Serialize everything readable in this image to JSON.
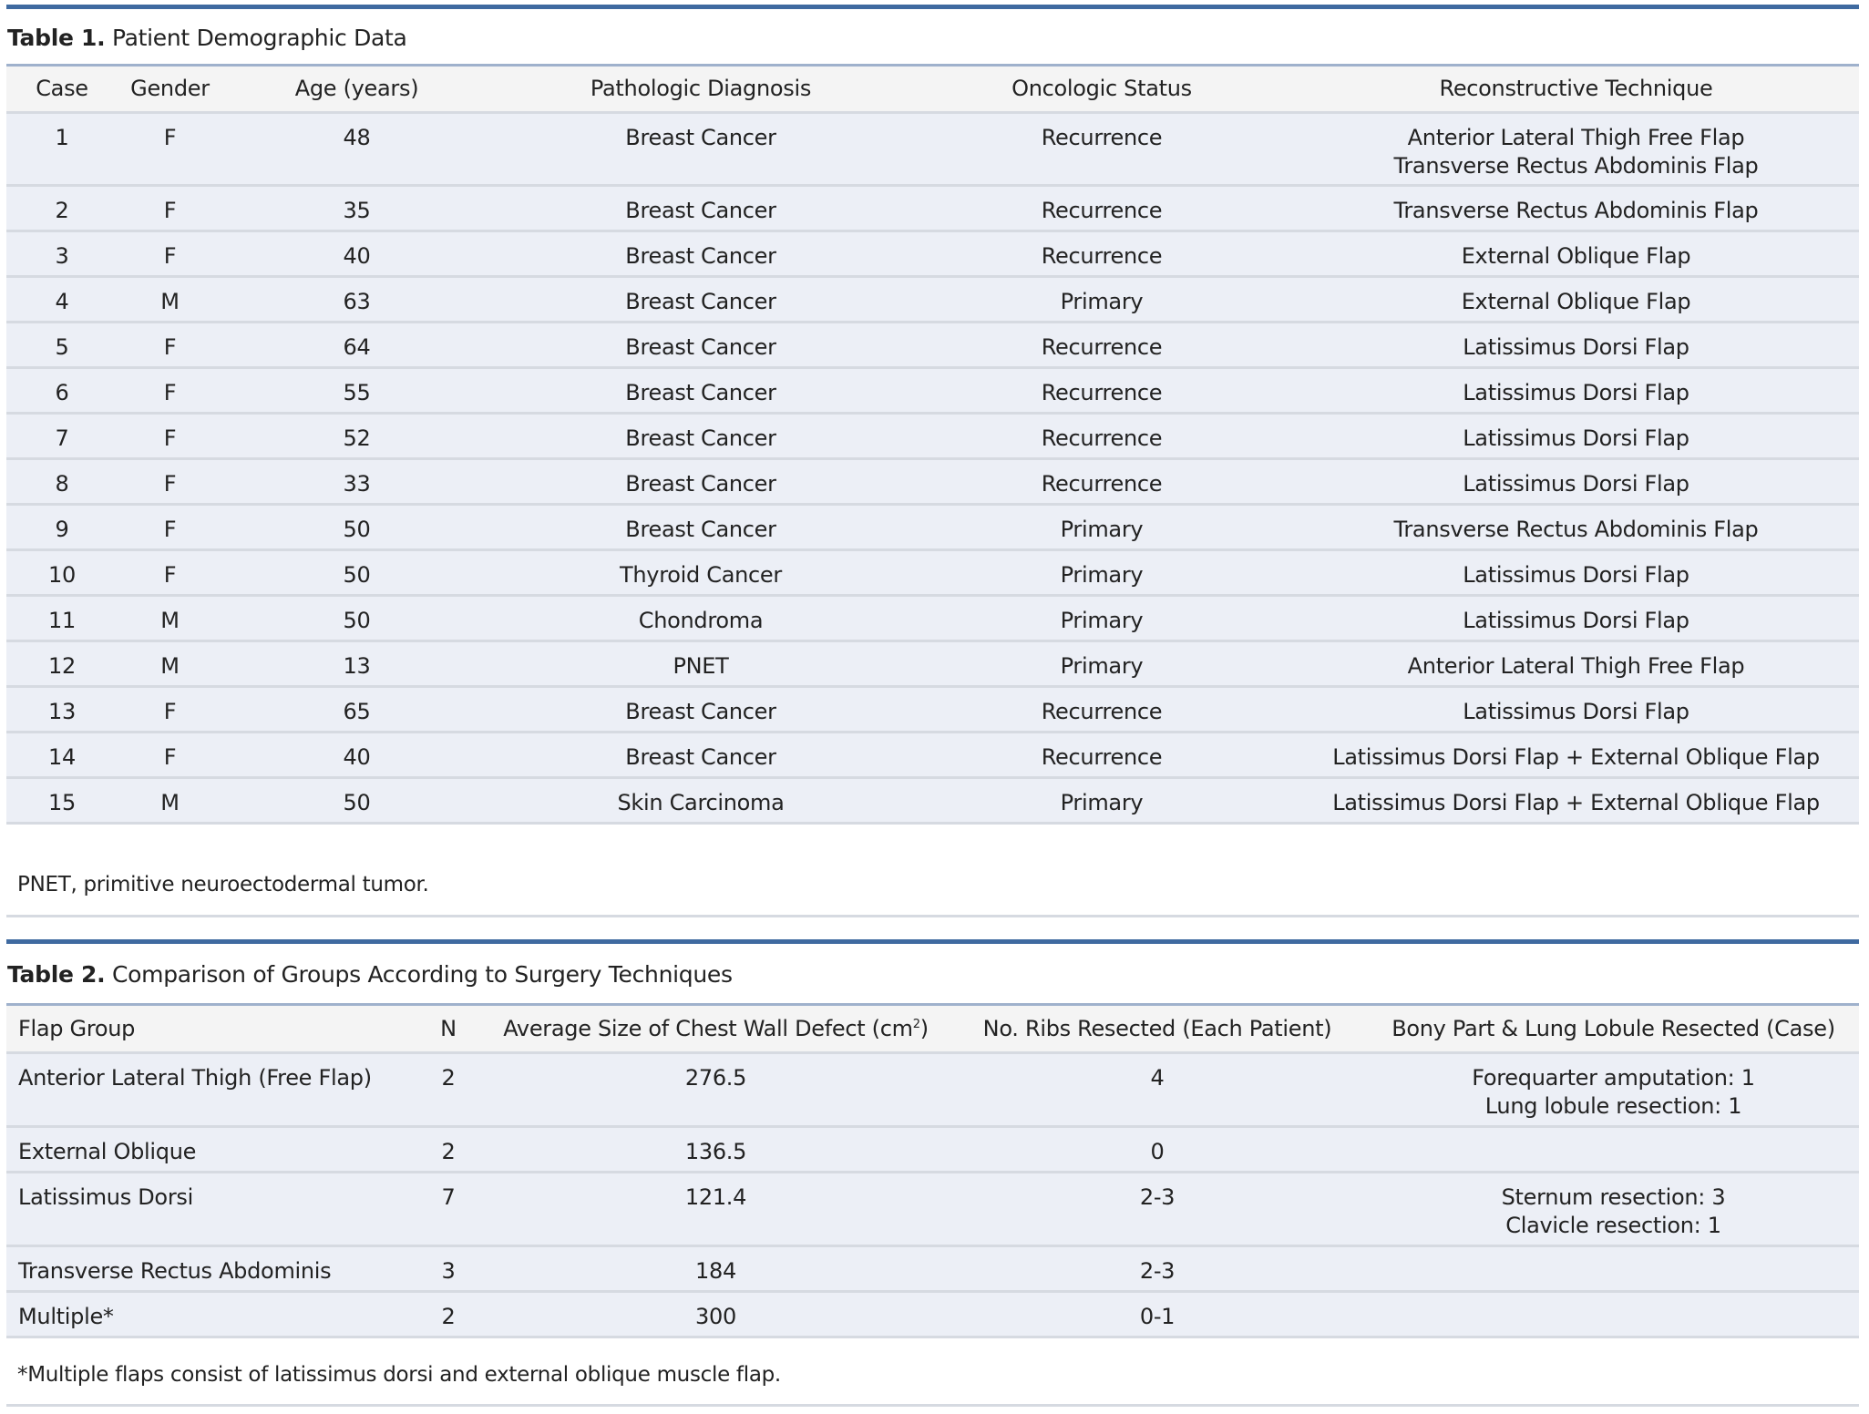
{
  "table1": {
    "label": "Table 1.",
    "title": "Patient Demographic Data",
    "headers": [
      "Case",
      "Gender",
      "Age (years)",
      "Pathologic Diagnosis",
      "Oncologic Status",
      "Reconstructive Technique"
    ],
    "rows": [
      {
        "case": "1",
        "gender": "F",
        "age": "48",
        "diagnosis": "Breast Cancer",
        "status": "Recurrence",
        "technique": [
          "Anterior Lateral Thigh Free Flap",
          "Transverse Rectus Abdominis Flap"
        ]
      },
      {
        "case": "2",
        "gender": "F",
        "age": "35",
        "diagnosis": "Breast Cancer",
        "status": "Recurrence",
        "technique": [
          "Transverse Rectus Abdominis Flap"
        ]
      },
      {
        "case": "3",
        "gender": "F",
        "age": "40",
        "diagnosis": "Breast Cancer",
        "status": "Recurrence",
        "technique": [
          "External Oblique Flap"
        ]
      },
      {
        "case": "4",
        "gender": "M",
        "age": "63",
        "diagnosis": "Breast Cancer",
        "status": "Primary",
        "technique": [
          "External Oblique Flap"
        ]
      },
      {
        "case": "5",
        "gender": "F",
        "age": "64",
        "diagnosis": "Breast Cancer",
        "status": "Recurrence",
        "technique": [
          "Latissimus Dorsi Flap"
        ]
      },
      {
        "case": "6",
        "gender": "F",
        "age": "55",
        "diagnosis": "Breast Cancer",
        "status": "Recurrence",
        "technique": [
          "Latissimus Dorsi Flap"
        ]
      },
      {
        "case": "7",
        "gender": "F",
        "age": "52",
        "diagnosis": "Breast Cancer",
        "status": "Recurrence",
        "technique": [
          "Latissimus Dorsi Flap"
        ]
      },
      {
        "case": "8",
        "gender": "F",
        "age": "33",
        "diagnosis": "Breast Cancer",
        "status": "Recurrence",
        "technique": [
          "Latissimus Dorsi Flap"
        ]
      },
      {
        "case": "9",
        "gender": "F",
        "age": "50",
        "diagnosis": "Breast Cancer",
        "status": "Primary",
        "technique": [
          "Transverse Rectus Abdominis Flap"
        ]
      },
      {
        "case": "10",
        "gender": "F",
        "age": "50",
        "diagnosis": "Thyroid Cancer",
        "status": "Primary",
        "technique": [
          "Latissimus Dorsi Flap"
        ]
      },
      {
        "case": "11",
        "gender": "M",
        "age": "50",
        "diagnosis": "Chondroma",
        "status": "Primary",
        "technique": [
          "Latissimus Dorsi Flap"
        ]
      },
      {
        "case": "12",
        "gender": "M",
        "age": "13",
        "diagnosis": "PNET",
        "status": "Primary",
        "technique": [
          "Anterior Lateral Thigh Free Flap"
        ]
      },
      {
        "case": "13",
        "gender": "F",
        "age": "65",
        "diagnosis": "Breast Cancer",
        "status": "Recurrence",
        "technique": [
          "Latissimus Dorsi Flap"
        ]
      },
      {
        "case": "14",
        "gender": "F",
        "age": "40",
        "diagnosis": "Breast Cancer",
        "status": "Recurrence",
        "technique": [
          "Latissimus Dorsi Flap + External Oblique Flap"
        ]
      },
      {
        "case": "15",
        "gender": "M",
        "age": "50",
        "diagnosis": "Skin Carcinoma",
        "status": "Primary",
        "technique": [
          "Latissimus Dorsi Flap + External Oblique Flap"
        ]
      }
    ],
    "footnote": "PNET, primitive neuroectodermal tumor."
  },
  "table2": {
    "label": "Table 2.",
    "title": "Comparison of Groups According to Surgery Techniques",
    "headers": [
      "Flap Group",
      "N",
      "Average Size of Chest Wall Defect (cm",
      "No. Ribs Resected (Each Patient)",
      "Bony Part & Lung Lobule Resected (Case)"
    ],
    "header_defect_superscript": "2",
    "header_defect_close": ")",
    "rows": [
      {
        "group": "Anterior Lateral Thigh (Free Flap)",
        "n": "2",
        "defect": "276.5",
        "ribs": "4",
        "bony": [
          "Forequarter amputation: 1",
          "Lung lobule resection: 1"
        ]
      },
      {
        "group": "External Oblique",
        "n": "2",
        "defect": "136.5",
        "ribs": "0",
        "bony": []
      },
      {
        "group": "Latissimus Dorsi",
        "n": "7",
        "defect": "121.4",
        "ribs": "2-3",
        "bony": [
          "Sternum resection: 3",
          "Clavicle resection: 1"
        ]
      },
      {
        "group": "Transverse Rectus Abdominis",
        "n": "3",
        "defect": "184",
        "ribs": "2-3",
        "bony": []
      },
      {
        "group": "Multiple*",
        "n": "2",
        "defect": "300",
        "ribs": "0-1",
        "bony": []
      }
    ],
    "footnote": "*Multiple flaps consist of latissimus dorsi and external oblique muscle flap."
  }
}
